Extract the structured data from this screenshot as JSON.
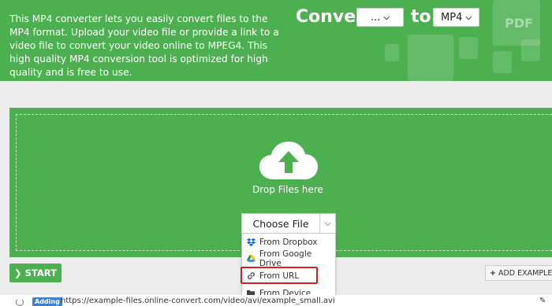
{
  "header": {
    "description": "This MP4 converter lets you easily convert files to the MP4 format. Upload your video file or provide a link to a video file to convert your video online to MPEG4. This high quality MP4 conversion tool is optimized for high quality and is free to use.",
    "convert_label": "Convert",
    "to_label": "to",
    "from_format": "...",
    "to_format": "MP4",
    "deco_pdf": "PDF"
  },
  "dropzone": {
    "label": "Drop Files here",
    "choose_file": "Choose File"
  },
  "menu": {
    "items": [
      {
        "label": "From Dropbox",
        "icon": "dropbox-icon"
      },
      {
        "label": "From Google Drive",
        "icon": "google-drive-icon"
      },
      {
        "label": "From URL",
        "icon": "link-icon"
      },
      {
        "label": "From Device",
        "icon": "folder-icon"
      }
    ]
  },
  "actions": {
    "start": "START",
    "add_example": "ADD EXAMPLE F"
  },
  "upload_row": {
    "badge": "Adding",
    "url": "https://example-files.online-convert.com/video/avi/example_small.avi"
  },
  "colors": {
    "brand_green": "#4caf50",
    "highlight_red": "#e21b1b",
    "badge_blue": "#3b82d4"
  }
}
